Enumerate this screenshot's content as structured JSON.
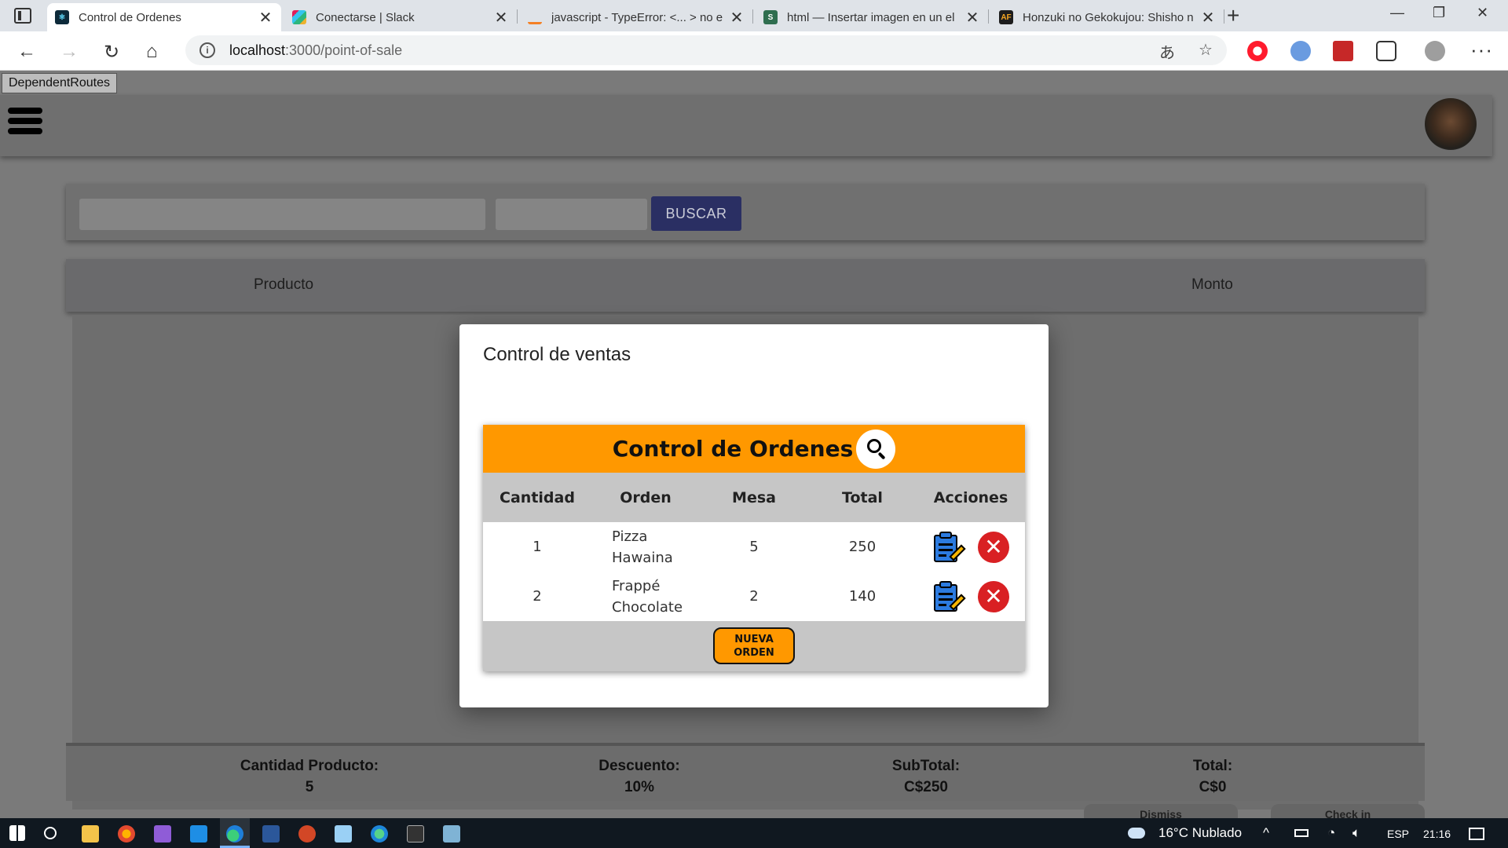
{
  "browser": {
    "tabs": [
      {
        "title": "Control de Ordenes",
        "active": true
      },
      {
        "title": "Conectarse | Slack",
        "active": false
      },
      {
        "title": "javascript - TypeError: <... > no e",
        "active": false
      },
      {
        "title": "html — Insertar imagen en un el",
        "active": false
      },
      {
        "title": "Honzuki no Gekokujou: Shisho n",
        "active": false
      }
    ],
    "favicon_text": {
      "honzuki": "AF",
      "html": "S"
    },
    "url_host": "localhost",
    "url_path": ":3000/point-of-sale",
    "new_tab": "+",
    "window_controls": {
      "minimize": "—",
      "restore": "❐",
      "close": "✕"
    }
  },
  "page": {
    "dependent_routes": "DependentRoutes",
    "search_button": "BUSCAR",
    "columns": {
      "product": "Producto",
      "amount": "Monto"
    },
    "totals": [
      {
        "label": "Cantidad Producto:",
        "value": "5"
      },
      {
        "label": "Descuento:",
        "value": "10%"
      },
      {
        "label": "SubTotal:",
        "value": "C$250"
      },
      {
        "label": "Total:",
        "value": "C$0"
      }
    ],
    "bottom_buttons": [
      "Dismiss",
      "Check in"
    ]
  },
  "modal": {
    "title": "Control de ventas",
    "orders": {
      "heading": "Control de Ordenes",
      "columns": [
        "Cantidad",
        "Orden",
        "Mesa",
        "Total",
        "Acciones"
      ],
      "rows": [
        {
          "cantidad": "1",
          "orden_line1": "Pizza",
          "orden_line2": "Hawaina",
          "mesa": "5",
          "total": "250"
        },
        {
          "cantidad": "2",
          "orden_line1": "Frappé",
          "orden_line2": "Chocolate",
          "mesa": "2",
          "total": "140"
        }
      ],
      "new_order_line1": "NUEVA",
      "new_order_line2": "ORDEN",
      "delete_glyph": "✕"
    },
    "accent_color": "#ff9800"
  },
  "taskbar": {
    "weather": "16°C  Nublado",
    "lang": "ESP",
    "time": "21:16"
  }
}
